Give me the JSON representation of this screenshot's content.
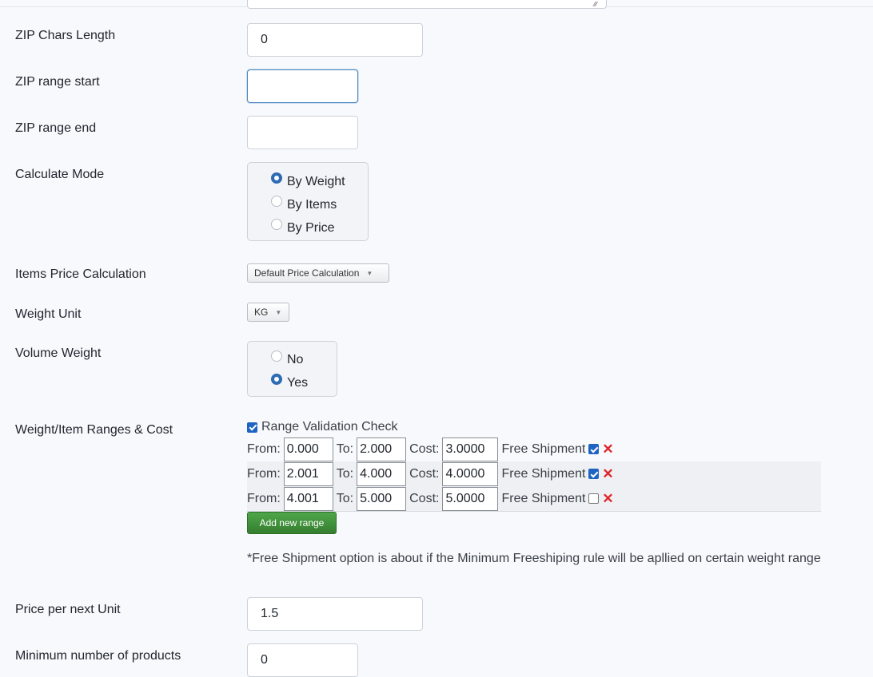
{
  "fields": {
    "zip_chars_length": {
      "label": "ZIP Chars Length",
      "value": "0"
    },
    "zip_range_start": {
      "label": "ZIP range start",
      "value": ""
    },
    "zip_range_end": {
      "label": "ZIP range end",
      "value": ""
    },
    "calculate_mode": {
      "label": "Calculate Mode",
      "options": [
        "By Weight",
        "By Items",
        "By Price"
      ],
      "selected": "By Weight"
    },
    "items_price_calculation": {
      "label": "Items Price Calculation",
      "selected": "Default Price Calculation"
    },
    "weight_unit": {
      "label": "Weight Unit",
      "selected": "KG"
    },
    "volume_weight": {
      "label": "Volume Weight",
      "options": [
        "No",
        "Yes"
      ],
      "selected": "Yes"
    },
    "weight_ranges": {
      "label": "Weight/Item Ranges & Cost",
      "validation_check_label": "Range Validation Check",
      "validation_checked": true,
      "from_label": "From:",
      "to_label": "To:",
      "cost_label": "Cost:",
      "free_shipment_label": "Free Shipment",
      "rows": [
        {
          "from": "0.000",
          "to": "2.000",
          "cost": "3.0000",
          "free_shipment": true
        },
        {
          "from": "2.001",
          "to": "4.000",
          "cost": "4.0000",
          "free_shipment": true
        },
        {
          "from": "4.001",
          "to": "5.000",
          "cost": "5.0000",
          "free_shipment": false
        }
      ],
      "add_button_label": "Add new range",
      "note": "*Free Shipment option is about if the Minimum Freeshiping rule will be apllied on certain weight range"
    },
    "price_per_next_unit": {
      "label": "Price per next Unit",
      "value": "1.5"
    },
    "minimum_number_of_products": {
      "label": "Minimum number of products",
      "value": "0"
    }
  },
  "icons": {
    "delete": "delete-x-icon",
    "select_arrow": "triangle-down-icon",
    "resize": "resize-grip-icon"
  },
  "colors": {
    "accent": "#2d6bb3",
    "add_button": "#3f9140",
    "delete": "#e0252a",
    "background": "#f7f9fc"
  }
}
